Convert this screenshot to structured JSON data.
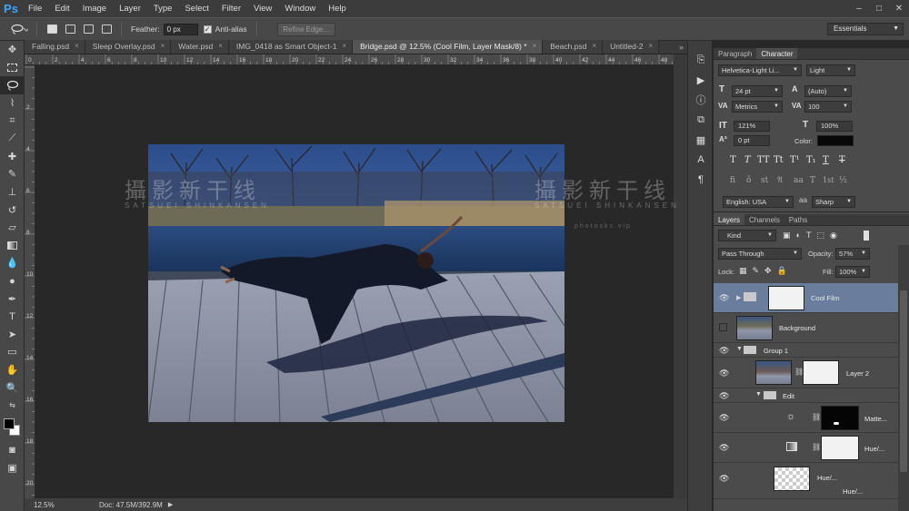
{
  "app": {
    "logo": "Ps"
  },
  "menu": [
    "File",
    "Edit",
    "Image",
    "Layer",
    "Type",
    "Select",
    "Filter",
    "View",
    "Window",
    "Help"
  ],
  "window_controls": {
    "minimize": "–",
    "maximize": "□",
    "close": "✕"
  },
  "options": {
    "feather_label": "Feather:",
    "feather_value": "0 px",
    "antialias_label": "Anti-alias",
    "antialias_checked": "✓",
    "refine_label": "Refine Edge...",
    "workspace": "Essentials"
  },
  "tabs": [
    {
      "label": "Falling.psd",
      "close": "×"
    },
    {
      "label": "Sleep Overlay.psd",
      "close": "×"
    },
    {
      "label": "Water.psd",
      "close": "×"
    },
    {
      "label": "IMG_0418 as Smart Object-1",
      "close": "×"
    },
    {
      "label": "Bridge.psd @ 12.5% (Cool Film, Layer Mask/8) *",
      "close": "×"
    },
    {
      "label": "Beach.psd",
      "close": "×"
    },
    {
      "label": "Untitled-2",
      "close": "×"
    }
  ],
  "tab_overflow": "»",
  "ruler": {
    "top_numbers": [
      "0",
      "2",
      "4",
      "6",
      "8",
      "10",
      "12",
      "14",
      "16",
      "18",
      "20",
      "22",
      "24",
      "26",
      "28",
      "30",
      "32",
      "34",
      "36",
      "38",
      "40",
      "42",
      "44",
      "46",
      "48"
    ],
    "left_numbers": [
      "2",
      "4",
      "6",
      "8",
      "10",
      "12",
      "14",
      "16",
      "18",
      "20"
    ]
  },
  "status": {
    "zoom": "12.5%",
    "doc": "Doc: 47.5M/392.9M",
    "arrow": "▶"
  },
  "watermark": {
    "left_text": "攝影新干线",
    "left_sub": "SATSUEI SHINKANSEN",
    "right_text": "攝影新干线",
    "right_sub": "SATSUEI SHINKANSEN",
    "url": "photosks.vip"
  },
  "char_panel": {
    "tabs": [
      "Paragraph",
      "Character"
    ],
    "font_family": "Helvetica-Light Li...",
    "font_style": "Light",
    "size": "24 pt",
    "leading": "(Auto)",
    "kerning": "Metrics",
    "tracking": "100",
    "vscale": "121%",
    "hscale": "100%",
    "baseline": "0 pt",
    "color_label": "Color:",
    "color_value": "#080808",
    "language": "English: USA",
    "aa_method": "Sharp",
    "type_buttons": [
      "T",
      "T",
      "TT",
      "Tt",
      "T¹",
      "T₁",
      "T",
      "T"
    ],
    "ot_buttons": [
      "fi",
      "ǒ",
      "st",
      "𝔄",
      "aa",
      "T",
      "1st",
      "½"
    ],
    "panel_icons": [
      "T",
      "A",
      "VA",
      "VA",
      "T",
      "T",
      "Aᵃ"
    ]
  },
  "layers_panel": {
    "tabs": [
      "Layers",
      "Channels",
      "Paths"
    ],
    "filter": "Kind",
    "blend": "Pass Through",
    "opacity_label": "Opacity:",
    "opacity": "57%",
    "lock_label": "Lock:",
    "fill_label": "Fill:",
    "fill": "100%",
    "layers": [
      {
        "name": "Cool Film",
        "visible": "👁"
      },
      {
        "name": "Background",
        "visible": ""
      },
      {
        "name": "Group 1",
        "visible": "👁"
      },
      {
        "name": "Layer 2",
        "visible": "👁"
      },
      {
        "name": "Edit",
        "visible": "👁"
      },
      {
        "name": "Matte...",
        "visible": "👁"
      },
      {
        "name": "Hue/...",
        "visible": "👁"
      },
      {
        "name": "Hue/...",
        "visible": "👁"
      },
      {
        "name": "Hue/...",
        "visible": ""
      }
    ]
  },
  "colors": {
    "accent": "#3ea3ff",
    "selection": "#6a7d9c"
  }
}
